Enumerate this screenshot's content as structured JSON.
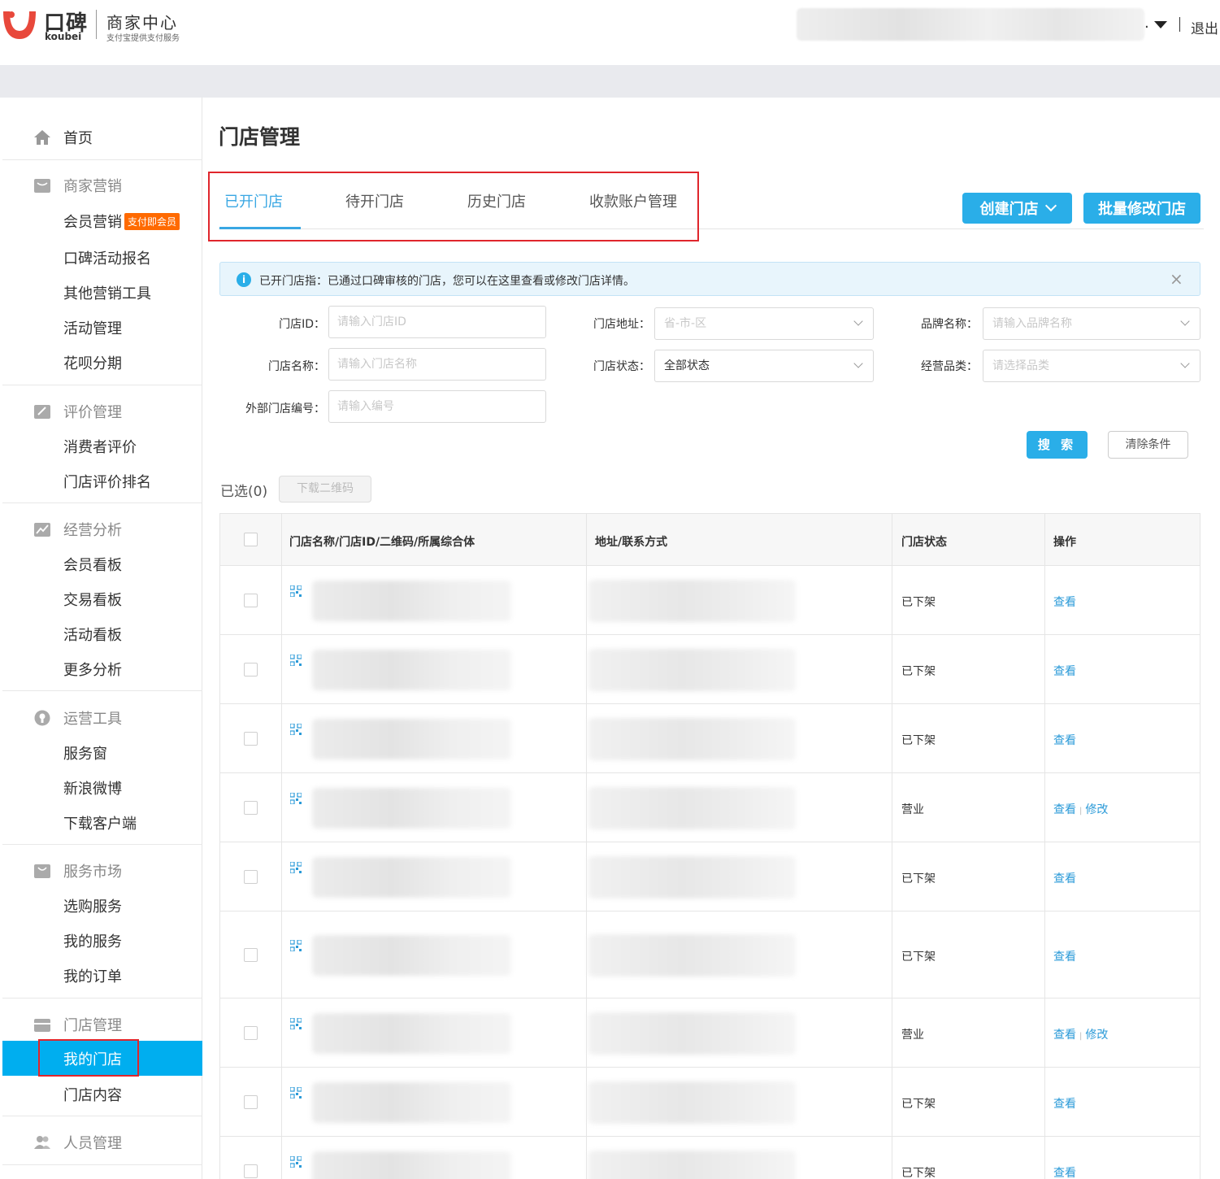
{
  "header": {
    "brand": "口碑",
    "brand_sub": "koubei",
    "center_title": "商家中心",
    "center_sub": "支付宝提供支付服务",
    "user_suffix": ".",
    "logout": "退出"
  },
  "sidebar": {
    "home": "首页",
    "groups": [
      {
        "label": "商家营销",
        "icon": "gift-icon",
        "items": [
          "会员营销",
          "口碑活动报名",
          "其他营销工具",
          "活动管理",
          "花呗分期"
        ],
        "badge": "支付即会员"
      },
      {
        "label": "评价管理",
        "icon": "edit-icon",
        "items": [
          "消费者评价",
          "门店评价排名"
        ]
      },
      {
        "label": "经营分析",
        "icon": "chart-icon",
        "items": [
          "会员看板",
          "交易看板",
          "活动看板",
          "更多分析"
        ]
      },
      {
        "label": "运营工具",
        "icon": "tool-icon",
        "items": [
          "服务窗",
          "新浪微博",
          "下载客户端"
        ]
      },
      {
        "label": "服务市场",
        "icon": "bag-icon",
        "items": [
          "选购服务",
          "我的服务",
          "我的订单"
        ]
      },
      {
        "label": "门店管理",
        "icon": "store-icon",
        "items": [
          "我的门店",
          "门店内容"
        ]
      },
      {
        "label": "人员管理",
        "icon": "people-icon",
        "items": []
      }
    ],
    "active_item": "我的门店"
  },
  "main": {
    "title": "门店管理",
    "tabs": [
      "已开门店",
      "待开门店",
      "历史门店",
      "收款账户管理"
    ],
    "active_tab": "已开门店",
    "create_btn": "创建门店",
    "batch_btn": "批量修改门店",
    "info": "已开门店指：已通过口碑审核的门店，您可以在这里查看或修改门店详情。",
    "info_close": "×"
  },
  "filters": {
    "store_id_label": "门店ID：",
    "store_id_ph": "请输入门店ID",
    "store_name_label": "门店名称：",
    "store_name_ph": "请输入门店名称",
    "ext_no_label": "外部门店编号：",
    "ext_no_ph": "请输入编号",
    "address_label": "门店地址：",
    "address_ph": "省-市-区",
    "status_label": "门店状态：",
    "status_value": "全部状态",
    "brand_label": "品牌名称：",
    "brand_ph": "请输入品牌名称",
    "category_label": "经营品类：",
    "category_ph": "请选择品类",
    "search_btn": "搜 索",
    "clear_btn": "清除条件"
  },
  "toolbar": {
    "selected": "已选(0)",
    "download_btn": "下载二维码"
  },
  "table": {
    "headers": [
      "门店名称/门店ID/二维码/所属综合体",
      "地址/联系方式",
      "门店状态",
      "操作"
    ],
    "view": "查看",
    "edit": "修改",
    "op_sep": "|",
    "rows": [
      {
        "status": "已下架"
      },
      {
        "status": "已下架"
      },
      {
        "status": "已下架"
      },
      {
        "status": "营业"
      },
      {
        "status": "已下架"
      },
      {
        "status": "已下架"
      },
      {
        "status": "营业"
      },
      {
        "status": "已下架"
      },
      {
        "status": "已下架"
      }
    ]
  },
  "colors": {
    "accent": "#2aaee8",
    "active_nav": "#00aeef",
    "badge": "#ff6a00",
    "highlight_box": "#e0262c"
  }
}
